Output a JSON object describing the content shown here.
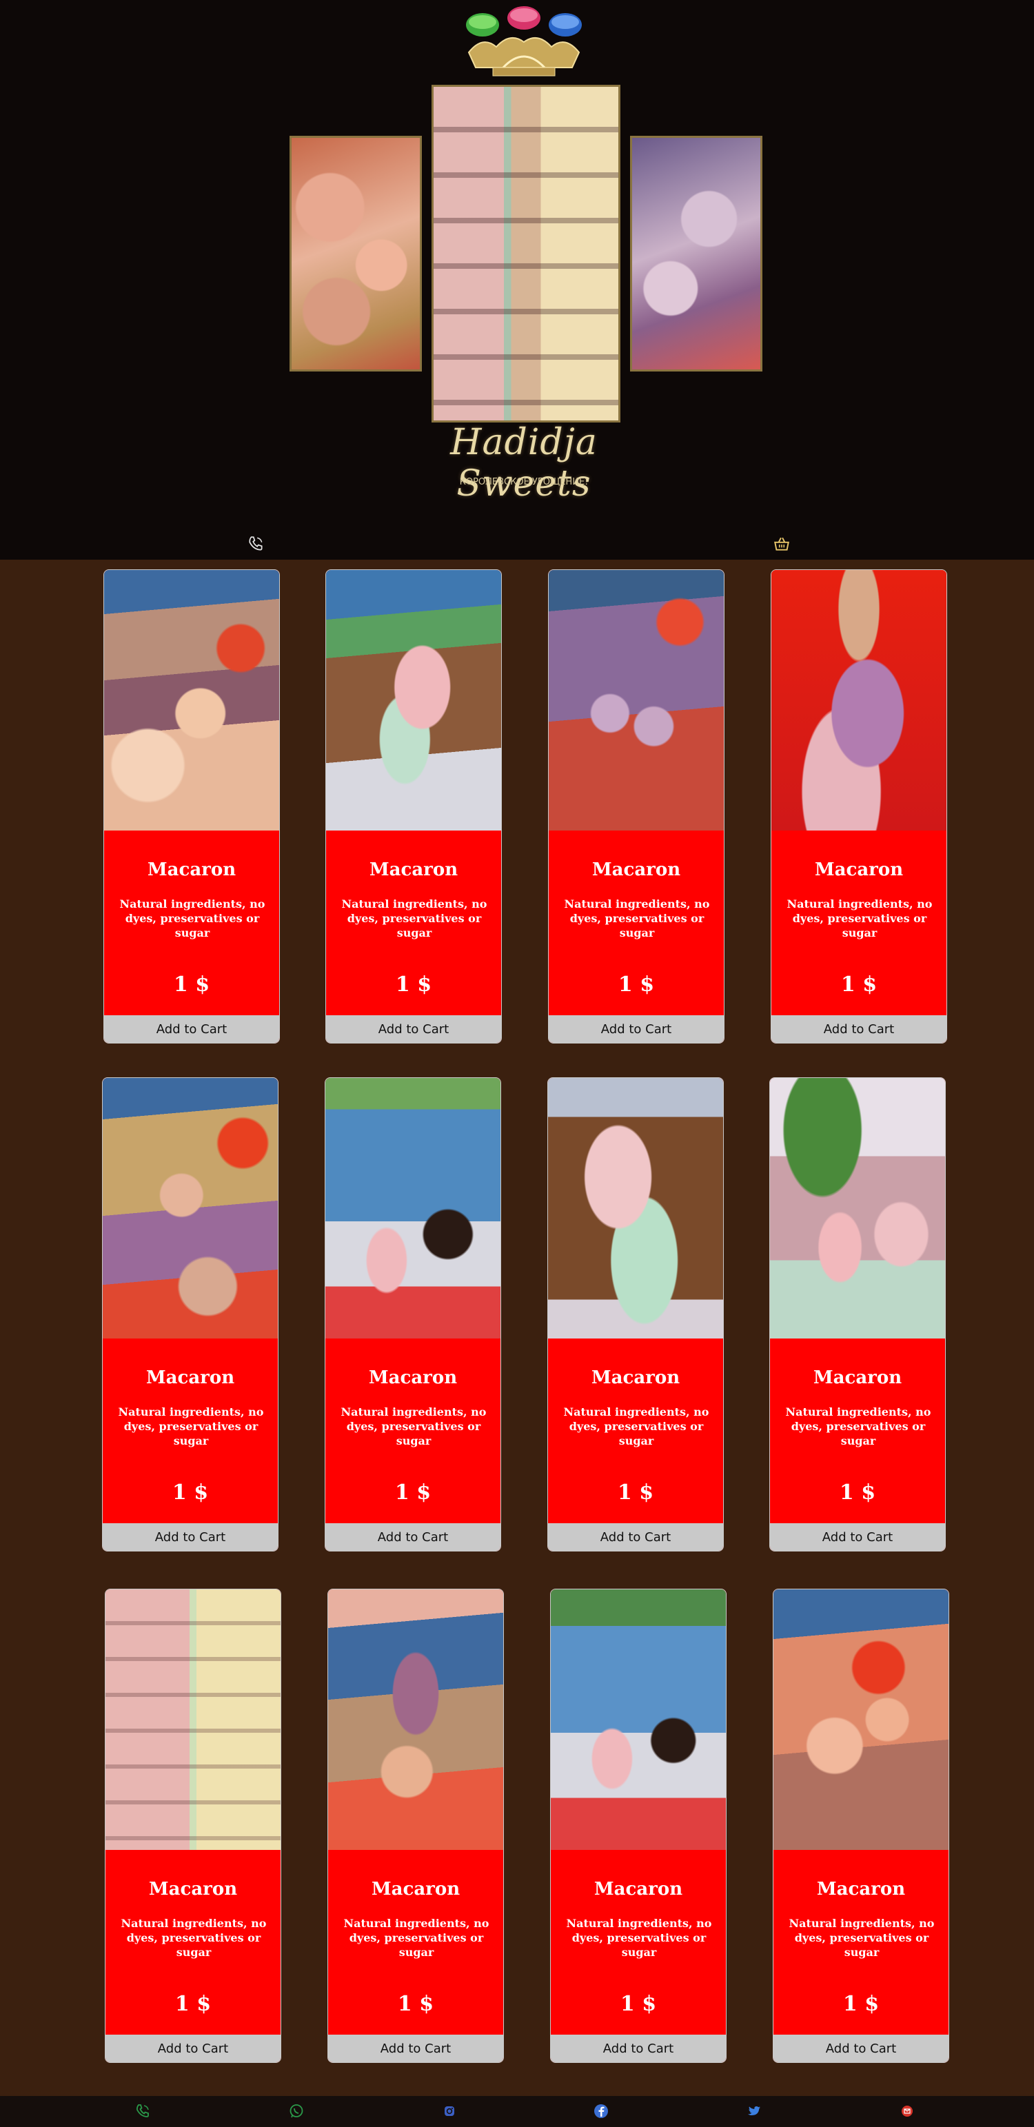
{
  "header": {
    "brand": "Hadidja Sweets",
    "tagline": "КОРОЛЕВСКОЕ УГОЩЕНИЕ!"
  },
  "icons": {
    "phone": "phone-icon",
    "cart": "basket-icon",
    "whatsapp": "whatsapp-icon",
    "instagram": "instagram-icon",
    "facebook": "facebook-icon",
    "twitter": "twitter-icon",
    "mail": "mail-icon"
  },
  "colors": {
    "header_bg": "#0d0807",
    "page_bg": "#3b200f",
    "card_bg": "#ff0000",
    "button_bg": "#c9c9c9",
    "accent_gold": "#d6c89b",
    "icon_green": "#2a9a4a",
    "icon_blue": "#3b5fc4"
  },
  "products": [
    {
      "title": "Macaron",
      "description": "Natural ingredients, no dyes, preservatives or sugar",
      "price": "1 $",
      "button": "Add to Cart",
      "image": "macarons-basket-roses"
    },
    {
      "title": "Macaron",
      "description": "Natural ingredients, no dyes, preservatives or sugar",
      "price": "1 $",
      "button": "Add to Cart",
      "image": "macarons-plate-love"
    },
    {
      "title": "Macaron",
      "description": "Natural ingredients, no dyes, preservatives or sugar",
      "price": "1 $",
      "button": "Add to Cart",
      "image": "macarons-purple-basket"
    },
    {
      "title": "Macaron",
      "description": "Natural ingredients, no dyes, preservatives or sugar",
      "price": "1 $",
      "button": "Add to Cart",
      "image": "macarons-stack-red"
    },
    {
      "title": "Macaron",
      "description": "Natural ingredients, no dyes, preservatives or sugar",
      "price": "1 $",
      "button": "Add to Cart",
      "image": "macarons-basket-gold"
    },
    {
      "title": "Macaron",
      "description": "Natural ingredients, no dyes, preservatives or sugar",
      "price": "1 $",
      "button": "Add to Cart",
      "image": "macarons-coffee-lilies"
    },
    {
      "title": "Macaron",
      "description": "Natural ingredients, no dyes, preservatives or sugar",
      "price": "1 $",
      "button": "Add to Cart",
      "image": "macarons-plate-closeup"
    },
    {
      "title": "Macaron",
      "description": "Natural ingredients, no dyes, preservatives or sugar",
      "price": "1 $",
      "button": "Add to Cart",
      "image": "macarons-row-leaves"
    },
    {
      "title": "Macaron",
      "description": "Natural ingredients, no dyes, preservatives or sugar",
      "price": "1 $",
      "button": "Add to Cart",
      "image": "macarons-columns"
    },
    {
      "title": "Macaron",
      "description": "Natural ingredients, no dyes, preservatives or sugar",
      "price": "1 $",
      "button": "Add to Cart",
      "image": "macarons-basket-sea"
    },
    {
      "title": "Macaron",
      "description": "Natural ingredients, no dyes, preservatives or sugar",
      "price": "1 $",
      "button": "Add to Cart",
      "image": "macarons-coffee-love"
    },
    {
      "title": "Macaron",
      "description": "Natural ingredients, no dyes, preservatives or sugar",
      "price": "1 $",
      "button": "Add to Cart",
      "image": "macarons-roses-sea"
    }
  ]
}
